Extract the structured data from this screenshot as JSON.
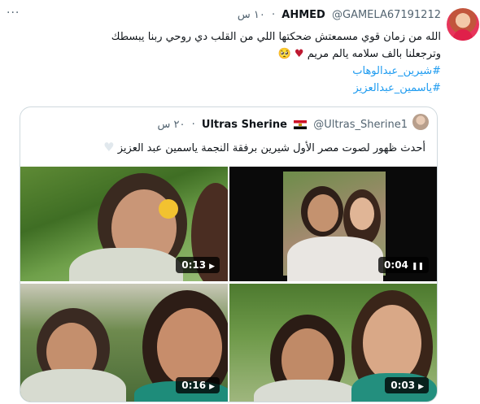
{
  "tweet": {
    "author_name": "AHMED",
    "author_handle": "@GAMELA67191212",
    "separator": "·",
    "time": "١٠ س",
    "line1": "الله من زمان قوي مسمعتش ضحكتها اللي من القلب دي روحي ربنا يبسطك",
    "line2": "وترجعلنا بالف سلامه يالم مريم",
    "emoji_heart": "♥",
    "emoji_face": "🥺",
    "hashtag1": "#شيرين_عبدالوهاب",
    "hashtag2": "#ياسمين_عبدالعزيز",
    "menu": "···"
  },
  "quoted": {
    "author_name": "Ultras Sherine",
    "author_handle": "@Ultras_Sherine1",
    "separator": "·",
    "time": "٢٠ س",
    "text": "أحدث ظهور لصوت مصر الأول شيرين برفقة النجمة ياسمين عبد العزيز",
    "emoji_heart": "♥",
    "videos": [
      {
        "duration": "0:13",
        "state_icon": "play-icon",
        "glyph": "▶"
      },
      {
        "duration": "0:04",
        "state_icon": "pause-icon",
        "glyph": "❚❚"
      },
      {
        "duration": "0:16",
        "state_icon": "play-icon",
        "glyph": "▶"
      },
      {
        "duration": "0:03",
        "state_icon": "play-icon",
        "glyph": "▶"
      }
    ]
  }
}
